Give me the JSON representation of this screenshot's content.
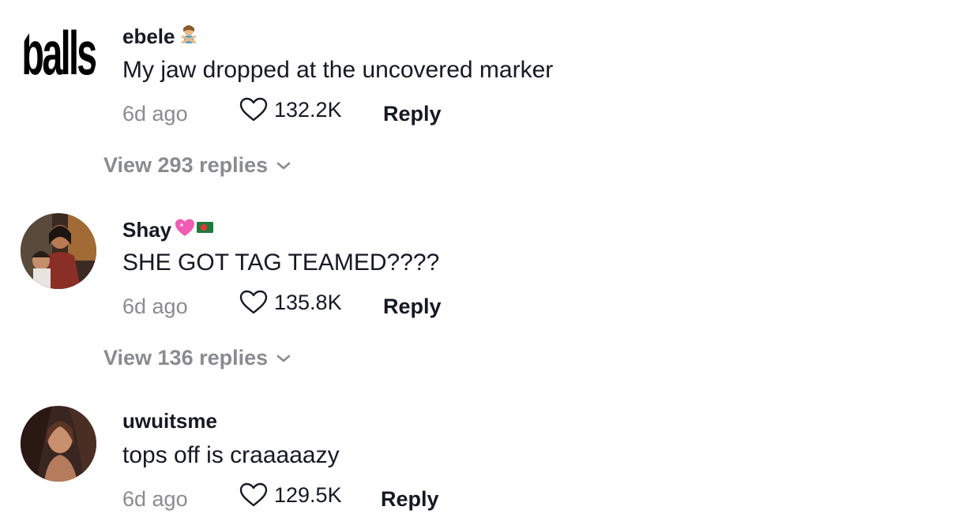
{
  "comments": [
    {
      "username": "ebele",
      "username_emoji": "woman-gesturing-no-emoji",
      "text": "My jaw dropped at the uncovered marker",
      "time": "6d ago",
      "likes": "132.2K",
      "reply_label": "Reply",
      "view_replies": "View 293 replies",
      "avatar_text": "balls"
    },
    {
      "username": "Shay",
      "username_emoji": "pink-heart-bangladesh-flag-emoji",
      "text": "SHE GOT TAG TEAMED????",
      "time": "6d ago",
      "likes": "135.8K",
      "reply_label": "Reply",
      "view_replies": "View 136 replies"
    },
    {
      "username": "uwuitsme",
      "text": "tops off is craaaaazy",
      "time": "6d ago",
      "likes": "129.5K",
      "reply_label": "Reply"
    }
  ],
  "colors": {
    "primary_text": "#161823",
    "secondary_text": "#8a8b91",
    "background": "#ffffff"
  }
}
